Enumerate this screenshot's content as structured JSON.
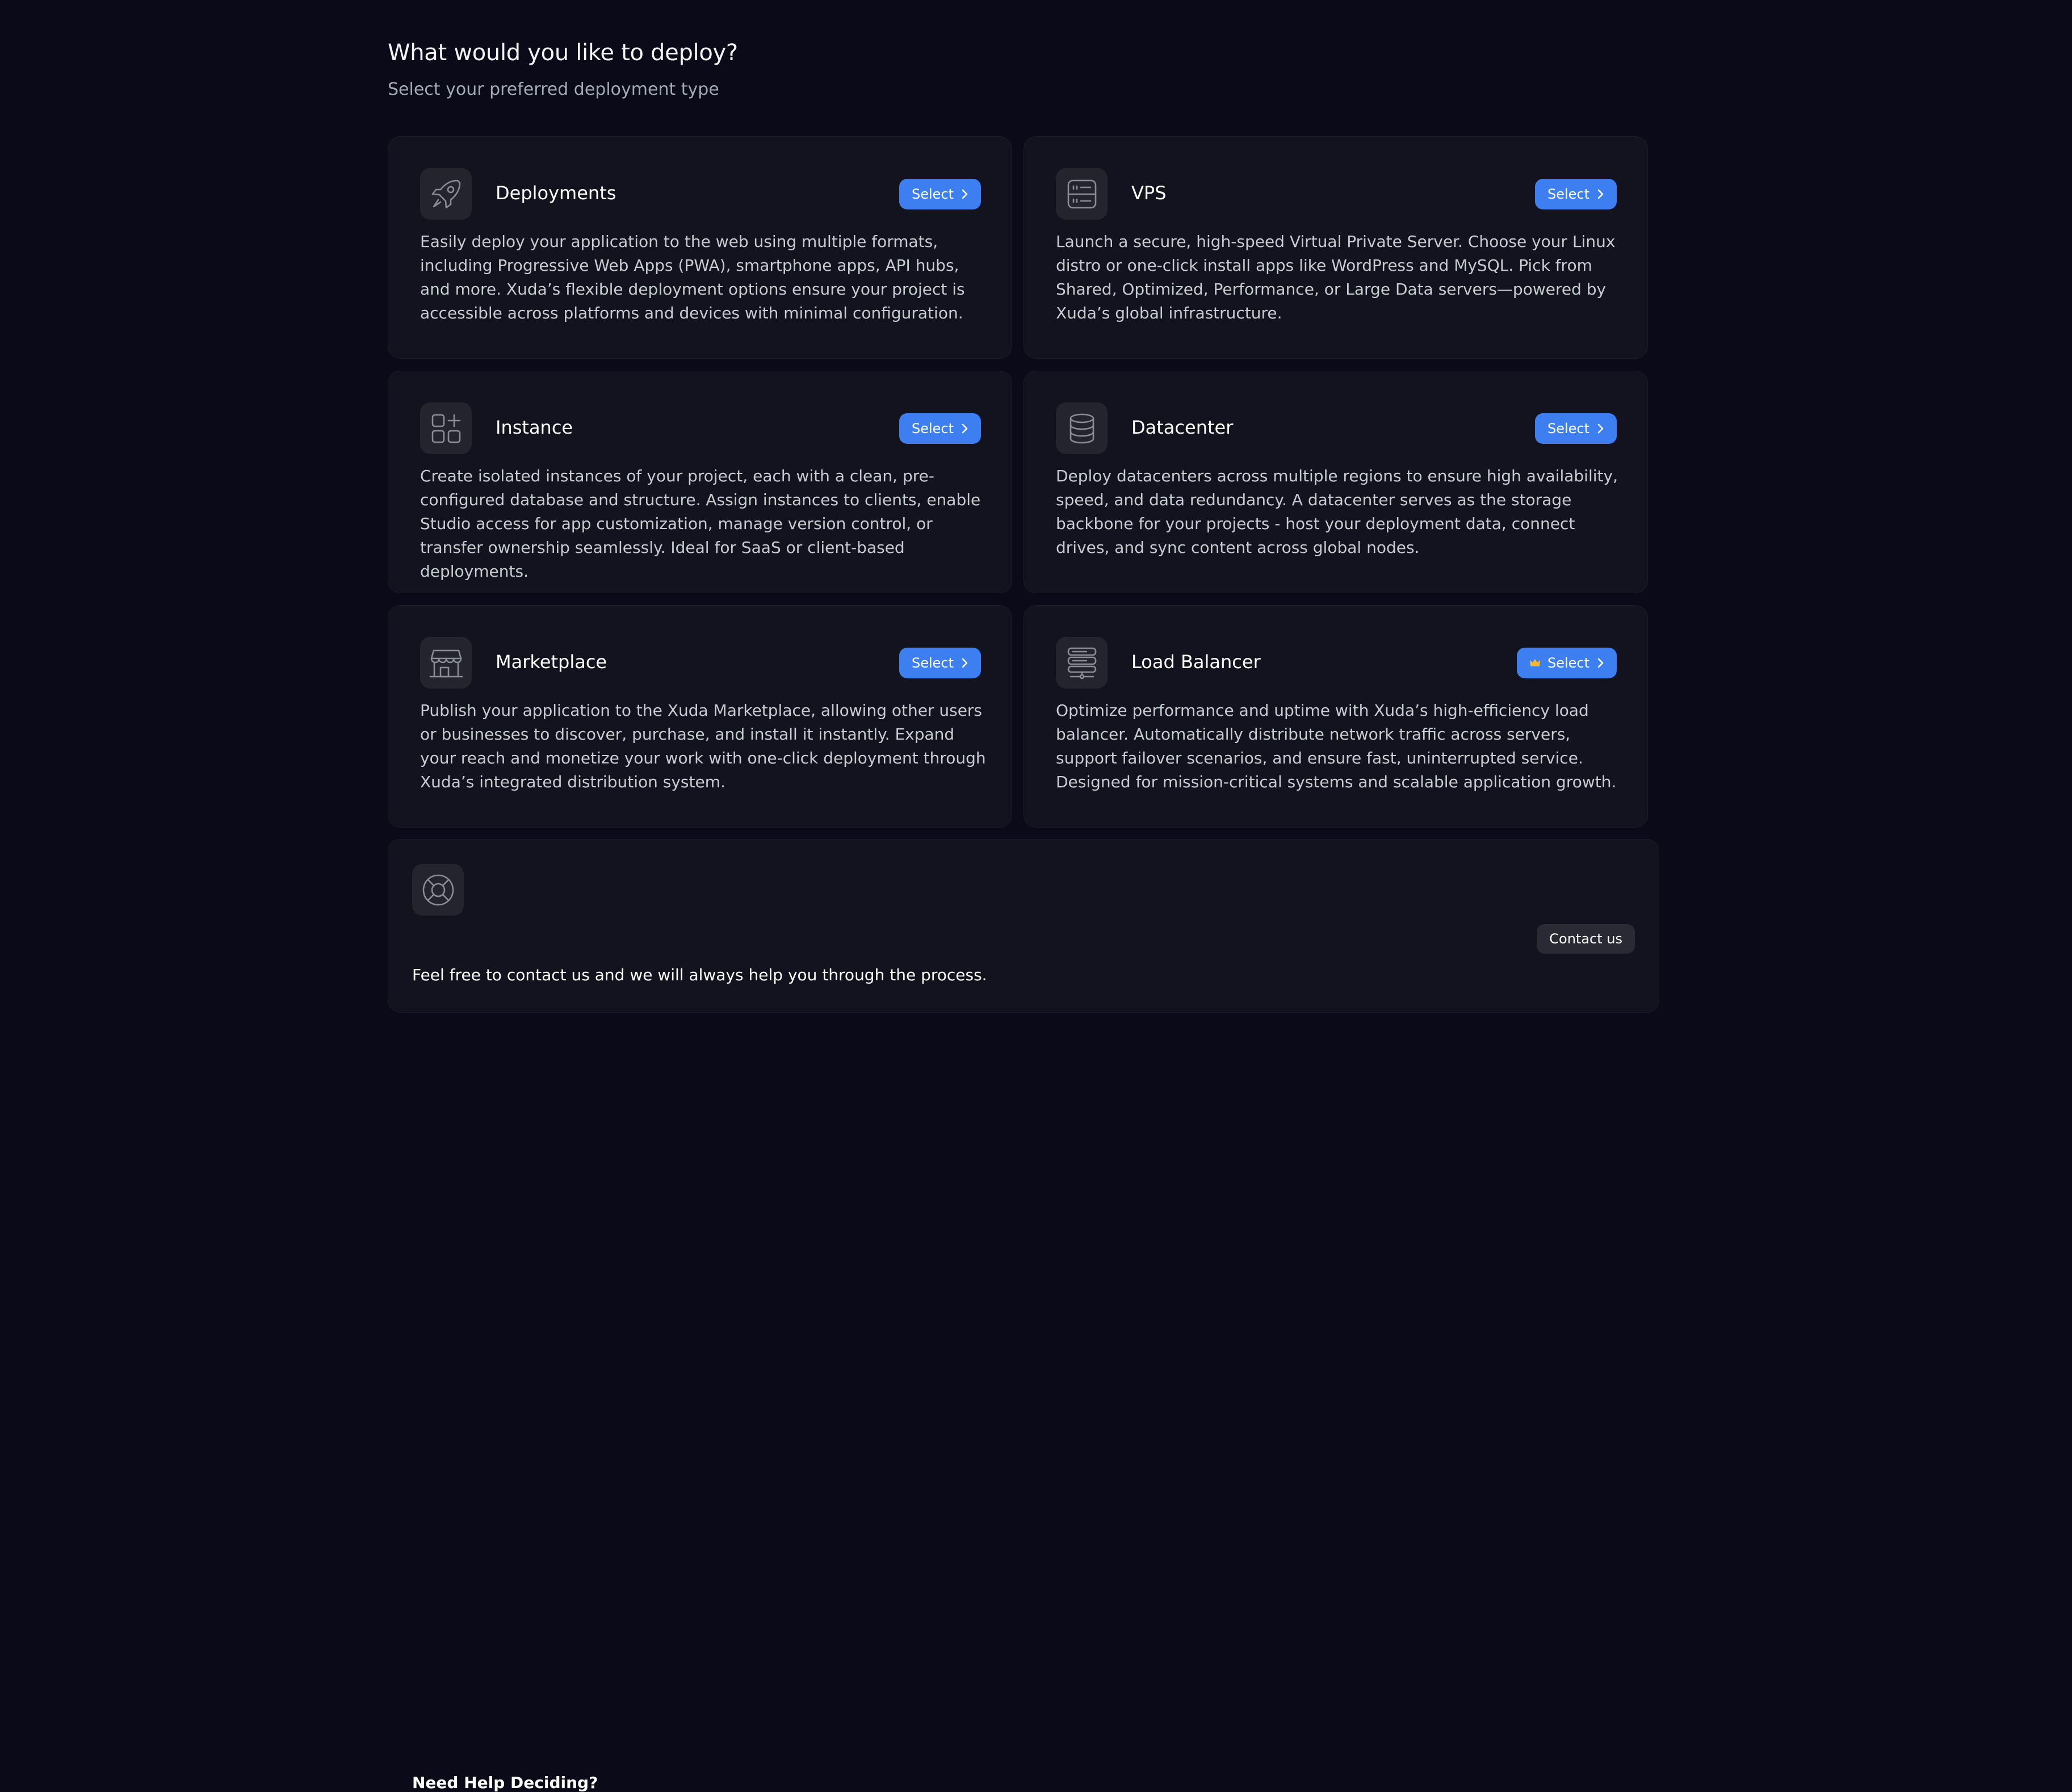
{
  "header": {
    "title": "What would you like to deploy?",
    "subtitle": "Select your preferred deployment type"
  },
  "cards": [
    {
      "title": "Deployments",
      "icon": "rocket-icon",
      "button": "Select",
      "description": "Easily deploy your application to the web using multiple formats, including Progressive Web Apps (PWA), smartphone apps, API hubs, and more. Xuda’s flexible deployment options ensure your project is accessible across platforms and devices with minimal configuration."
    },
    {
      "title": "VPS",
      "icon": "server-icon",
      "button": "Select",
      "description": "Launch a secure, high-speed Virtual Private Server. Choose your Linux distro or one-click install apps like WordPress and MySQL. Pick from Shared, Optimized, Performance, or Large Data servers—powered by Xuda’s global infrastructure."
    },
    {
      "title": "Instance",
      "icon": "apps-grid-icon",
      "button": "Select",
      "description": "Create isolated instances of your project, each with a clean, pre-configured database and structure. Assign instances to clients, enable Studio access for app customization, manage version control, or transfer ownership seamlessly. Ideal for SaaS or client-based deployments."
    },
    {
      "title": "Datacenter",
      "icon": "database-icon",
      "button": "Select",
      "description": "Deploy datacenters across multiple regions to ensure high availability, speed, and data redundancy. A datacenter serves as the storage backbone for your projects - host your deployment data, connect drives, and sync content across global nodes."
    },
    {
      "title": "Marketplace",
      "icon": "store-icon",
      "button": "Select",
      "description": "Publish your application to the Xuda Marketplace, allowing other users or businesses to discover, purchase, and install it instantly. Expand your reach and monetize your work with one-click deployment through Xuda’s integrated distribution system."
    },
    {
      "title": "Load Balancer",
      "icon": "server-stack-icon",
      "button": "Select",
      "premium_badge": "crown-icon",
      "description": "Optimize performance and uptime with Xuda’s high-efficiency load balancer. Automatically distribute network traffic across servers, support failover scenarios, and ensure fast, uninterrupted service. Designed for mission-critical systems and scalable application growth."
    }
  ],
  "help": {
    "icon": "lifebuoy-icon",
    "title": "Need Help Deciding?",
    "text": "Feel free to contact us and we will always help you through the process.",
    "button": "Contact us"
  },
  "colors": {
    "background": "#0a0a18",
    "card": "#13131f",
    "accent": "#3d7ff0",
    "crown": "#f5b82e"
  }
}
